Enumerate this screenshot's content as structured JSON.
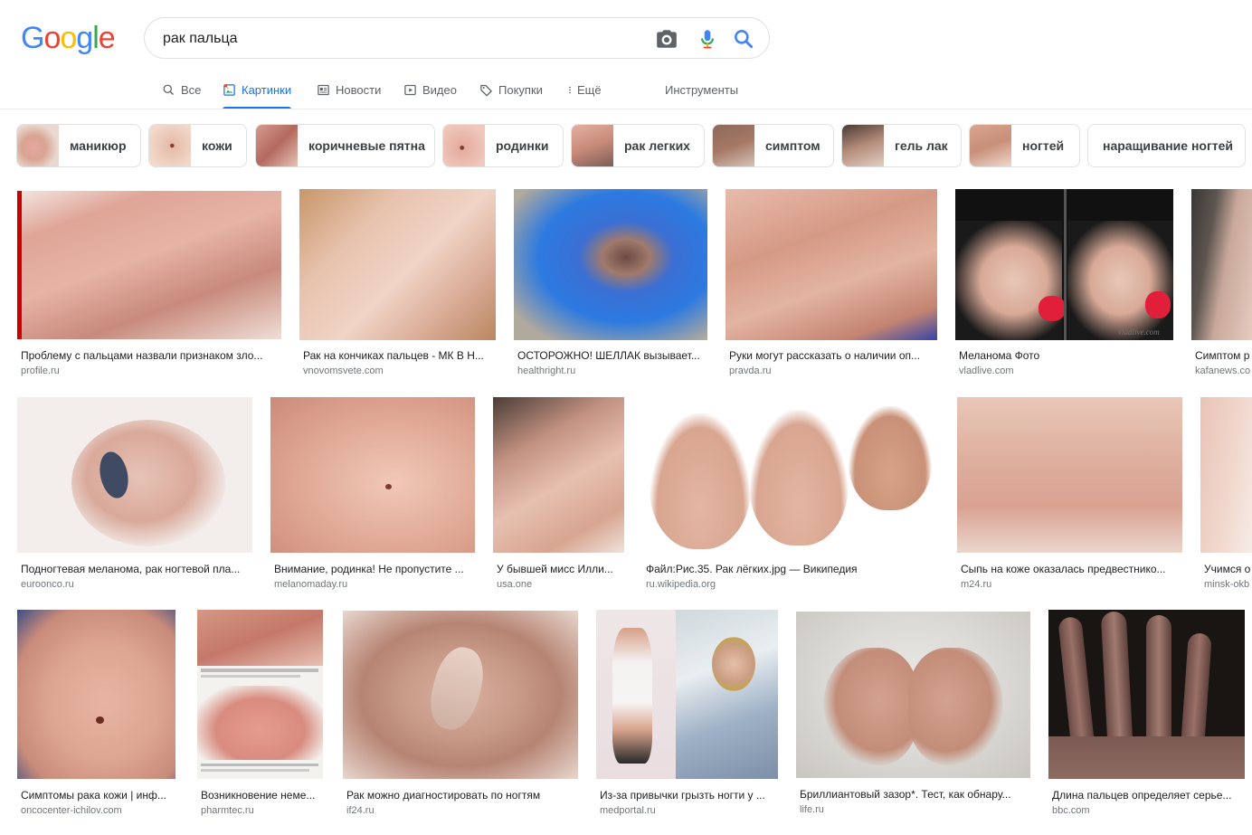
{
  "logo_text": "Google",
  "search": {
    "query": "рак пальца",
    "camera_icon": "camera-icon",
    "mic_icon": "mic-icon",
    "search_icon": "search-icon"
  },
  "tabs": [
    {
      "label": "Все",
      "icon": "search-icon",
      "active": false
    },
    {
      "label": "Картинки",
      "icon": "image-icon",
      "active": true
    },
    {
      "label": "Новости",
      "icon": "news-icon",
      "active": false
    },
    {
      "label": "Видео",
      "icon": "video-icon",
      "active": false
    },
    {
      "label": "Покупки",
      "icon": "tag-icon",
      "active": false
    },
    {
      "label": "Ещё",
      "icon": "more-vertical-icon",
      "active": false
    }
  ],
  "tools_label": "Инструменты",
  "chips": [
    {
      "label": "маникюр"
    },
    {
      "label": "кожи"
    },
    {
      "label": "коричневые пятна"
    },
    {
      "label": "родинки"
    },
    {
      "label": "рак легких"
    },
    {
      "label": "симптом"
    },
    {
      "label": "гель лак"
    },
    {
      "label": "ногтей"
    },
    {
      "label": "наращивание ногтей"
    }
  ],
  "results": [
    {
      "title": "Проблему с пальцами назвали признаком зло...",
      "source": "profile.ru"
    },
    {
      "title": "Рак на кончиках пальцев - МК В Н...",
      "source": "vnovomsvete.com"
    },
    {
      "title": "ОСТОРОЖНО! ШЕЛЛАК вызывает...",
      "source": "healthright.ru"
    },
    {
      "title": "Руки могут рассказать о наличии оп...",
      "source": "pravda.ru"
    },
    {
      "title": "Меланома Фото",
      "source": "vladlive.com"
    },
    {
      "title": "Симптом р",
      "source": "kafanews.co"
    },
    {
      "title": "Подногтевая меланома, рак ногтевой пла...",
      "source": "euroonco.ru"
    },
    {
      "title": "Внимание, родинка! Не пропустите ...",
      "source": "melanomaday.ru"
    },
    {
      "title": "У бывшей мисс Илли...",
      "source": "usa.one"
    },
    {
      "title": "Файл:Рис.35. Рак лёгких.jpg — Википедия",
      "source": "ru.wikipedia.org"
    },
    {
      "title": "Сыпь на коже оказалась предвестнико...",
      "source": "m24.ru"
    },
    {
      "title": "Учимся о",
      "source": "minsk-okb"
    },
    {
      "title": "Симптомы рака кожи | инф...",
      "source": "oncocenter-ichilov.com"
    },
    {
      "title": "Возникновение неме...",
      "source": "pharmtec.ru"
    },
    {
      "title": "Рак можно диагностировать по ногтям",
      "source": "if24.ru"
    },
    {
      "title": "Из-за привычки грызть ногти у ...",
      "source": "medportal.ru"
    },
    {
      "title": "Бриллиантовый зазор*. Тест, как обнару...",
      "source": "life.ru"
    },
    {
      "title": "Длина пальцев определяет серье...",
      "source": "bbc.com"
    }
  ],
  "watermark_vladlive": "vladlive.com",
  "colors": {
    "accent": "#1a73e8",
    "text": "#202124",
    "muted": "#70757a",
    "border": "#dfe1e5"
  }
}
